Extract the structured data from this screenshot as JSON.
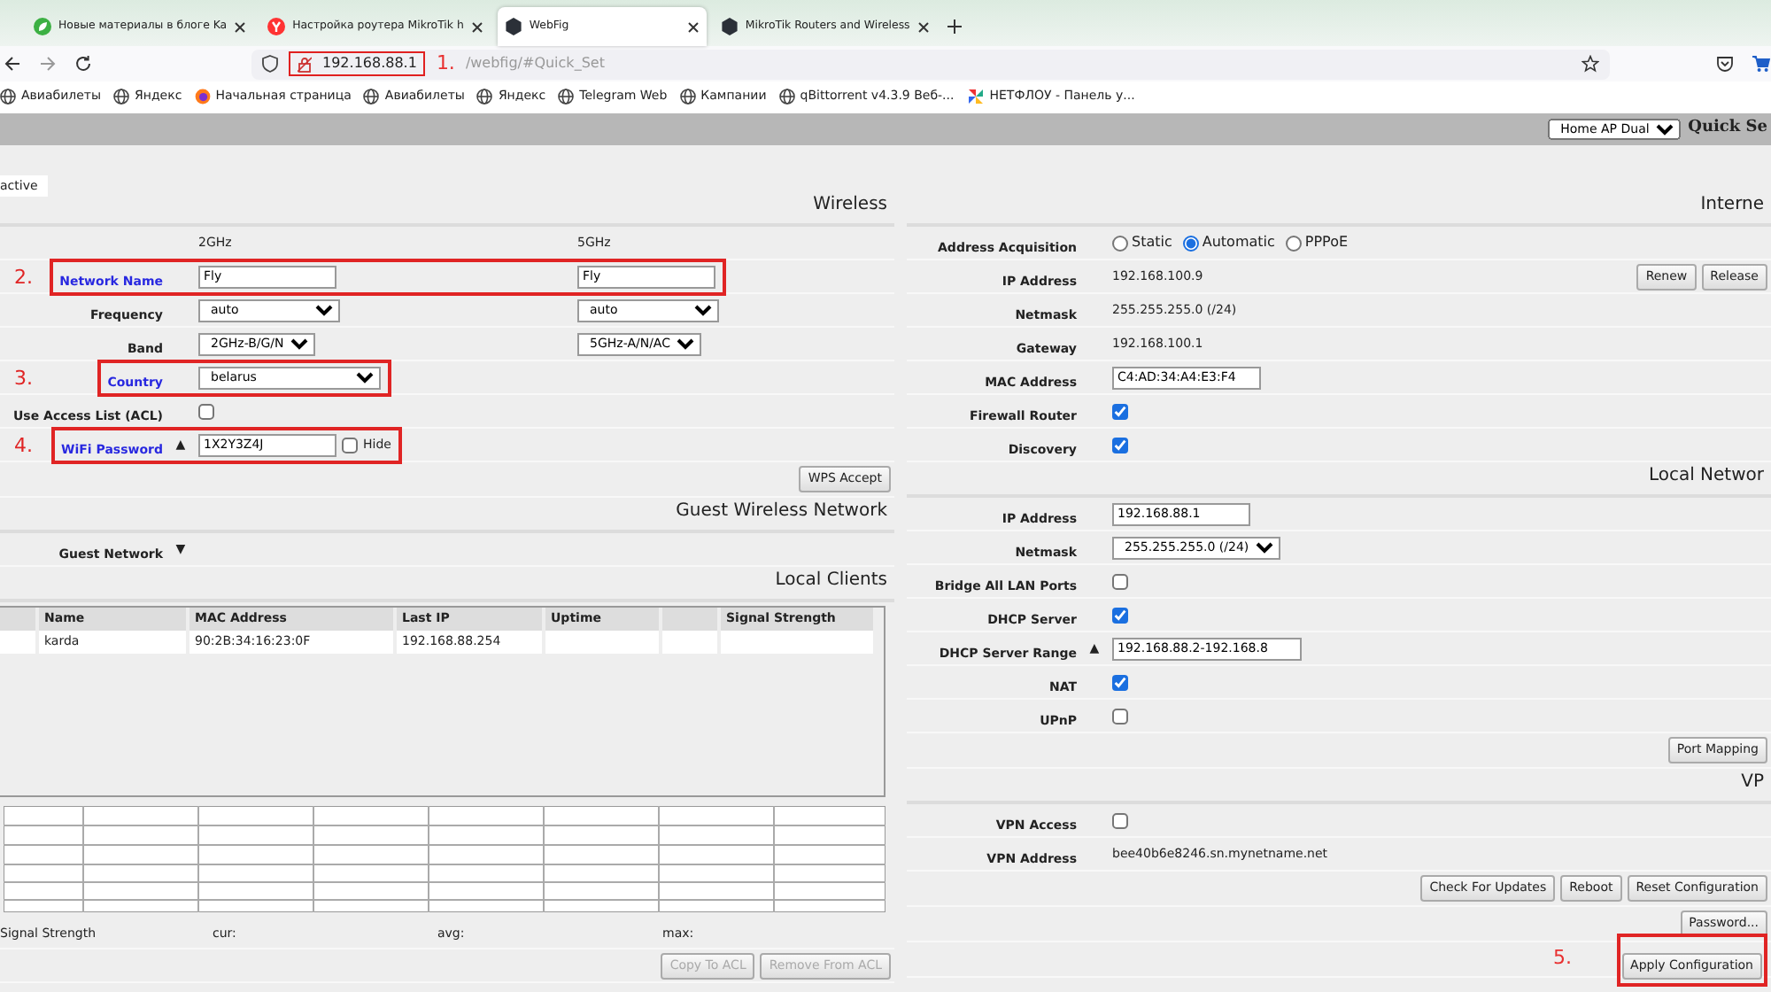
{
  "browser": {
    "tabs": [
      {
        "title": "Новые материалы в блоге Ka",
        "kind": "leaf",
        "selected": false
      },
      {
        "title": "Настройка роутера MikroTik h",
        "kind": "circle",
        "selected": false
      },
      {
        "title": "WebFig",
        "kind": "hexagon",
        "selected": true
      },
      {
        "title": "MikroTik Routers and Wireless",
        "kind": "hexagon",
        "selected": false
      }
    ],
    "address": {
      "host": "192.168.88.1",
      "annotation": "1.",
      "path": "/webfig/#Quick_Set"
    },
    "bookmarks": [
      {
        "label": "Авиабилеты",
        "kind": "globe"
      },
      {
        "label": "Яндекс",
        "kind": "globe"
      },
      {
        "label": "Начальная страница",
        "kind": "flame"
      },
      {
        "label": "Авиабилеты",
        "kind": "globe"
      },
      {
        "label": "Яндекс",
        "kind": "globe"
      },
      {
        "label": "Telegram Web",
        "kind": "globe"
      },
      {
        "label": "Кампании",
        "kind": "globe"
      },
      {
        "label": "qBittorrent v4.3.9 Веб-...",
        "kind": "globe"
      },
      {
        "label": "НЕТФЛОУ - Панель у...",
        "kind": "pinwheel"
      }
    ]
  },
  "toolbar": {
    "mode": "Home AP Dual",
    "title": "Quick Se"
  },
  "view_tab": {
    "label": "active",
    "selected": true
  },
  "wireless": {
    "title": "Wireless",
    "columns": [
      "2GHz",
      "5GHz"
    ],
    "rows": [
      {
        "kind": "inputs",
        "label": "Network Name",
        "highlighted": true,
        "annotation": "2.",
        "values": [
          "Fly",
          "Fly"
        ]
      },
      {
        "kind": "selects",
        "label": "Frequency",
        "highlighted": false,
        "values": [
          "auto",
          "auto"
        ]
      },
      {
        "kind": "selects",
        "label": "Band",
        "highlighted": false,
        "values": [
          "2GHz-B/G/N",
          "5GHz-A/N/AC"
        ]
      },
      {
        "kind": "selects",
        "label": "Country",
        "highlighted": true,
        "annotation": "3.",
        "values": [
          "belarus"
        ]
      },
      {
        "kind": "checkbox",
        "label": "Use Access List (ACL)",
        "highlighted": false,
        "checked": false
      },
      {
        "kind": "password",
        "label": "WiFi Password",
        "highlighted": true,
        "annotation": "4.",
        "toggle": "▲",
        "value": "1X2Y3Z4J",
        "hide": {
          "label": "Hide",
          "checked": false
        }
      },
      {
        "kind": "buttons",
        "buttons": [
          {
            "label": "WPS Accept",
            "disabled": false
          }
        ]
      }
    ]
  },
  "guest_wireless": {
    "title": "Guest Wireless Network",
    "rows": [
      {
        "kind": "toggle",
        "label": "Guest Network",
        "highlighted": false,
        "toggle": "▼"
      }
    ]
  },
  "local_clients": {
    "title": "Local Clients",
    "columns": [
      "Name",
      "MAC Address",
      "Last IP",
      "Uptime",
      "Signal Strength"
    ],
    "rows": [
      {
        "name": "karda",
        "mac": "90:2B:34:16:23:0F",
        "last_ip": "192.168.88.254"
      }
    ],
    "signal": {
      "label": "Signal Strength",
      "stats": [
        "cur:",
        "avg:",
        "max:"
      ]
    },
    "buttons": [
      {
        "label": "Copy To ACL",
        "disabled": true
      },
      {
        "label": "Remove From ACL",
        "disabled": true
      }
    ]
  },
  "internet": {
    "title": "Interne",
    "rows": [
      {
        "kind": "radios",
        "label": "Address Acquisition",
        "options": [
          {
            "label": "Static",
            "selected": false
          },
          {
            "label": "Automatic",
            "selected": true
          },
          {
            "label": "PPPoE",
            "selected": false
          }
        ]
      },
      {
        "kind": "text",
        "label": "IP Address",
        "value": "192.168.100.9",
        "buttons": [
          {
            "label": "Renew",
            "disabled": false
          },
          {
            "label": "Release",
            "disabled": false
          }
        ]
      },
      {
        "kind": "text",
        "label": "Netmask",
        "value": "255.255.255.0 (/24)"
      },
      {
        "kind": "text",
        "label": "Gateway",
        "value": "192.168.100.1"
      },
      {
        "kind": "inputs",
        "label": "MAC Address",
        "values": [
          "C4:AD:34:A4:E3:F4"
        ]
      },
      {
        "kind": "checkbox",
        "label": "Firewall Router",
        "checked": true
      },
      {
        "kind": "checkbox",
        "label": "Discovery",
        "checked": true
      }
    ]
  },
  "local_network": {
    "title": "Local Networ",
    "rows": [
      {
        "kind": "inputs",
        "label": "IP Address",
        "values": [
          "192.168.88.1"
        ]
      },
      {
        "kind": "selects",
        "label": "Netmask",
        "values": [
          "255.255.255.0 (/24)"
        ]
      },
      {
        "kind": "checkbox",
        "label": "Bridge All LAN Ports",
        "checked": false
      },
      {
        "kind": "checkbox",
        "label": "DHCP Server",
        "checked": true
      },
      {
        "kind": "inputs",
        "label": "DHCP Server Range",
        "toggle": "▲",
        "values": [
          "192.168.88.2-192.168.8"
        ]
      },
      {
        "kind": "checkbox",
        "label": "NAT",
        "checked": true
      },
      {
        "kind": "checkbox",
        "label": "UPnP",
        "checked": false
      },
      {
        "kind": "buttons",
        "buttons": [
          {
            "label": "Port Mapping",
            "disabled": false
          }
        ]
      }
    ]
  },
  "vpn": {
    "title": "VP",
    "rows": [
      {
        "kind": "checkbox",
        "label": "VPN Access",
        "checked": false
      },
      {
        "kind": "text",
        "label": "VPN Address",
        "value": "bee40b6e8246.sn.mynetname.net"
      },
      {
        "kind": "buttons",
        "buttons": [
          {
            "label": "Check For Updates",
            "disabled": false
          },
          {
            "label": "Reboot",
            "disabled": false
          },
          {
            "label": "Reset Configuration",
            "disabled": false
          }
        ]
      },
      {
        "kind": "buttons",
        "buttons": [
          {
            "label": "Password...",
            "disabled": false
          }
        ]
      },
      {
        "kind": "buttons",
        "annotation": "5.",
        "buttons": [
          {
            "label": "Apply Configuration",
            "disabled": false
          }
        ]
      }
    ]
  }
}
